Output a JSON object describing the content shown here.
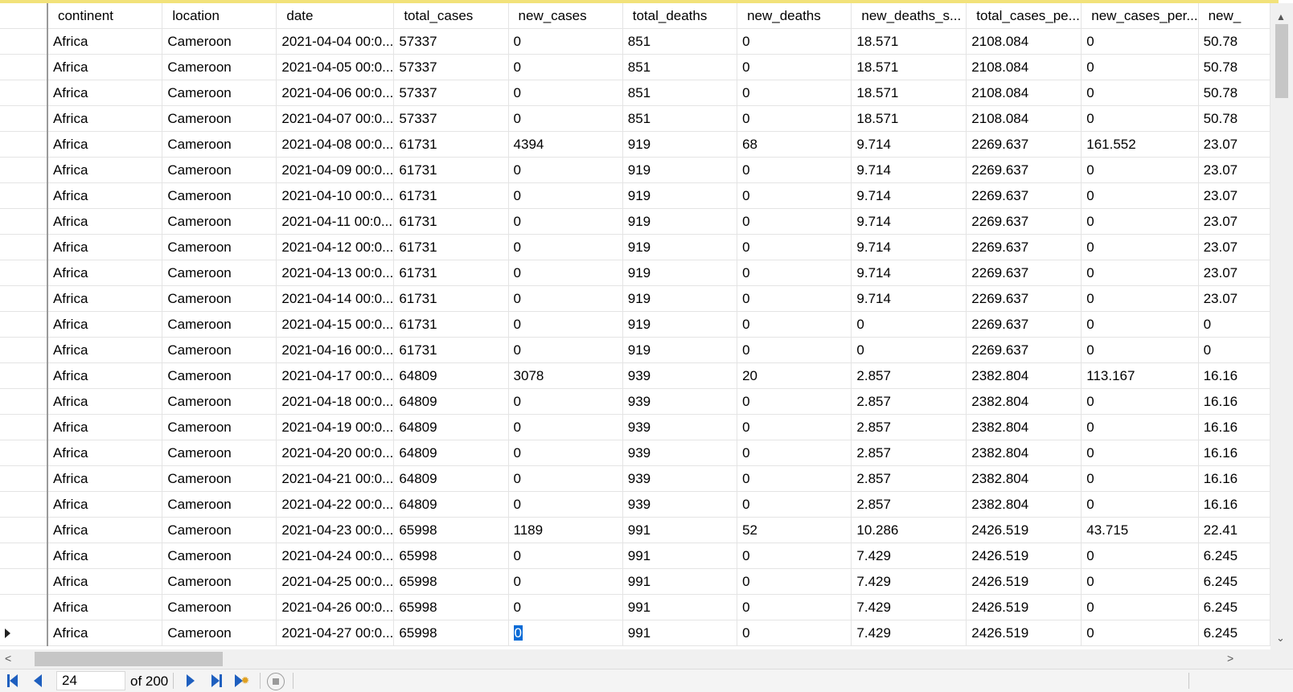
{
  "grid": {
    "columns": [
      "continent",
      "location",
      "date",
      "total_cases",
      "new_cases",
      "total_deaths",
      "new_deaths",
      "new_deaths_s...",
      "total_cases_pe...",
      "new_cases_per...",
      "new_"
    ],
    "rows": [
      [
        "Africa",
        "Cameroon",
        "2021-04-04 00:0...",
        "57337",
        "0",
        "851",
        "0",
        "18.571",
        "2108.084",
        "0",
        "50.78"
      ],
      [
        "Africa",
        "Cameroon",
        "2021-04-05 00:0...",
        "57337",
        "0",
        "851",
        "0",
        "18.571",
        "2108.084",
        "0",
        "50.78"
      ],
      [
        "Africa",
        "Cameroon",
        "2021-04-06 00:0...",
        "57337",
        "0",
        "851",
        "0",
        "18.571",
        "2108.084",
        "0",
        "50.78"
      ],
      [
        "Africa",
        "Cameroon",
        "2021-04-07 00:0...",
        "57337",
        "0",
        "851",
        "0",
        "18.571",
        "2108.084",
        "0",
        "50.78"
      ],
      [
        "Africa",
        "Cameroon",
        "2021-04-08 00:0...",
        "61731",
        "4394",
        "919",
        "68",
        "9.714",
        "2269.637",
        "161.552",
        "23.07"
      ],
      [
        "Africa",
        "Cameroon",
        "2021-04-09 00:0...",
        "61731",
        "0",
        "919",
        "0",
        "9.714",
        "2269.637",
        "0",
        "23.07"
      ],
      [
        "Africa",
        "Cameroon",
        "2021-04-10 00:0...",
        "61731",
        "0",
        "919",
        "0",
        "9.714",
        "2269.637",
        "0",
        "23.07"
      ],
      [
        "Africa",
        "Cameroon",
        "2021-04-11 00:0...",
        "61731",
        "0",
        "919",
        "0",
        "9.714",
        "2269.637",
        "0",
        "23.07"
      ],
      [
        "Africa",
        "Cameroon",
        "2021-04-12 00:0...",
        "61731",
        "0",
        "919",
        "0",
        "9.714",
        "2269.637",
        "0",
        "23.07"
      ],
      [
        "Africa",
        "Cameroon",
        "2021-04-13 00:0...",
        "61731",
        "0",
        "919",
        "0",
        "9.714",
        "2269.637",
        "0",
        "23.07"
      ],
      [
        "Africa",
        "Cameroon",
        "2021-04-14 00:0...",
        "61731",
        "0",
        "919",
        "0",
        "9.714",
        "2269.637",
        "0",
        "23.07"
      ],
      [
        "Africa",
        "Cameroon",
        "2021-04-15 00:0...",
        "61731",
        "0",
        "919",
        "0",
        "0",
        "2269.637",
        "0",
        "0"
      ],
      [
        "Africa",
        "Cameroon",
        "2021-04-16 00:0...",
        "61731",
        "0",
        "919",
        "0",
        "0",
        "2269.637",
        "0",
        "0"
      ],
      [
        "Africa",
        "Cameroon",
        "2021-04-17 00:0...",
        "64809",
        "3078",
        "939",
        "20",
        "2.857",
        "2382.804",
        "113.167",
        "16.16"
      ],
      [
        "Africa",
        "Cameroon",
        "2021-04-18 00:0...",
        "64809",
        "0",
        "939",
        "0",
        "2.857",
        "2382.804",
        "0",
        "16.16"
      ],
      [
        "Africa",
        "Cameroon",
        "2021-04-19 00:0...",
        "64809",
        "0",
        "939",
        "0",
        "2.857",
        "2382.804",
        "0",
        "16.16"
      ],
      [
        "Africa",
        "Cameroon",
        "2021-04-20 00:0...",
        "64809",
        "0",
        "939",
        "0",
        "2.857",
        "2382.804",
        "0",
        "16.16"
      ],
      [
        "Africa",
        "Cameroon",
        "2021-04-21 00:0...",
        "64809",
        "0",
        "939",
        "0",
        "2.857",
        "2382.804",
        "0",
        "16.16"
      ],
      [
        "Africa",
        "Cameroon",
        "2021-04-22 00:0...",
        "64809",
        "0",
        "939",
        "0",
        "2.857",
        "2382.804",
        "0",
        "16.16"
      ],
      [
        "Africa",
        "Cameroon",
        "2021-04-23 00:0...",
        "65998",
        "1189",
        "991",
        "52",
        "10.286",
        "2426.519",
        "43.715",
        "22.41"
      ],
      [
        "Africa",
        "Cameroon",
        "2021-04-24 00:0...",
        "65998",
        "0",
        "991",
        "0",
        "7.429",
        "2426.519",
        "0",
        "6.245"
      ],
      [
        "Africa",
        "Cameroon",
        "2021-04-25 00:0...",
        "65998",
        "0",
        "991",
        "0",
        "7.429",
        "2426.519",
        "0",
        "6.245"
      ],
      [
        "Africa",
        "Cameroon",
        "2021-04-26 00:0...",
        "65998",
        "0",
        "991",
        "0",
        "7.429",
        "2426.519",
        "0",
        "6.245"
      ],
      [
        "Africa",
        "Cameroon",
        "2021-04-27 00:0...",
        "65998",
        "0",
        "991",
        "0",
        "7.429",
        "2426.519",
        "0",
        "6.245"
      ]
    ],
    "current_row_index": 23,
    "selected_cell": {
      "row": 23,
      "col": 4
    },
    "selection_color": "#0a6bd6"
  },
  "navigator": {
    "position_value": "24",
    "of_label": "of 200",
    "icons": [
      "first-record-icon",
      "previous-record-icon",
      "next-record-icon",
      "last-record-icon",
      "new-record-icon",
      "stop-icon"
    ],
    "accent_color": "#1e5fbf"
  }
}
